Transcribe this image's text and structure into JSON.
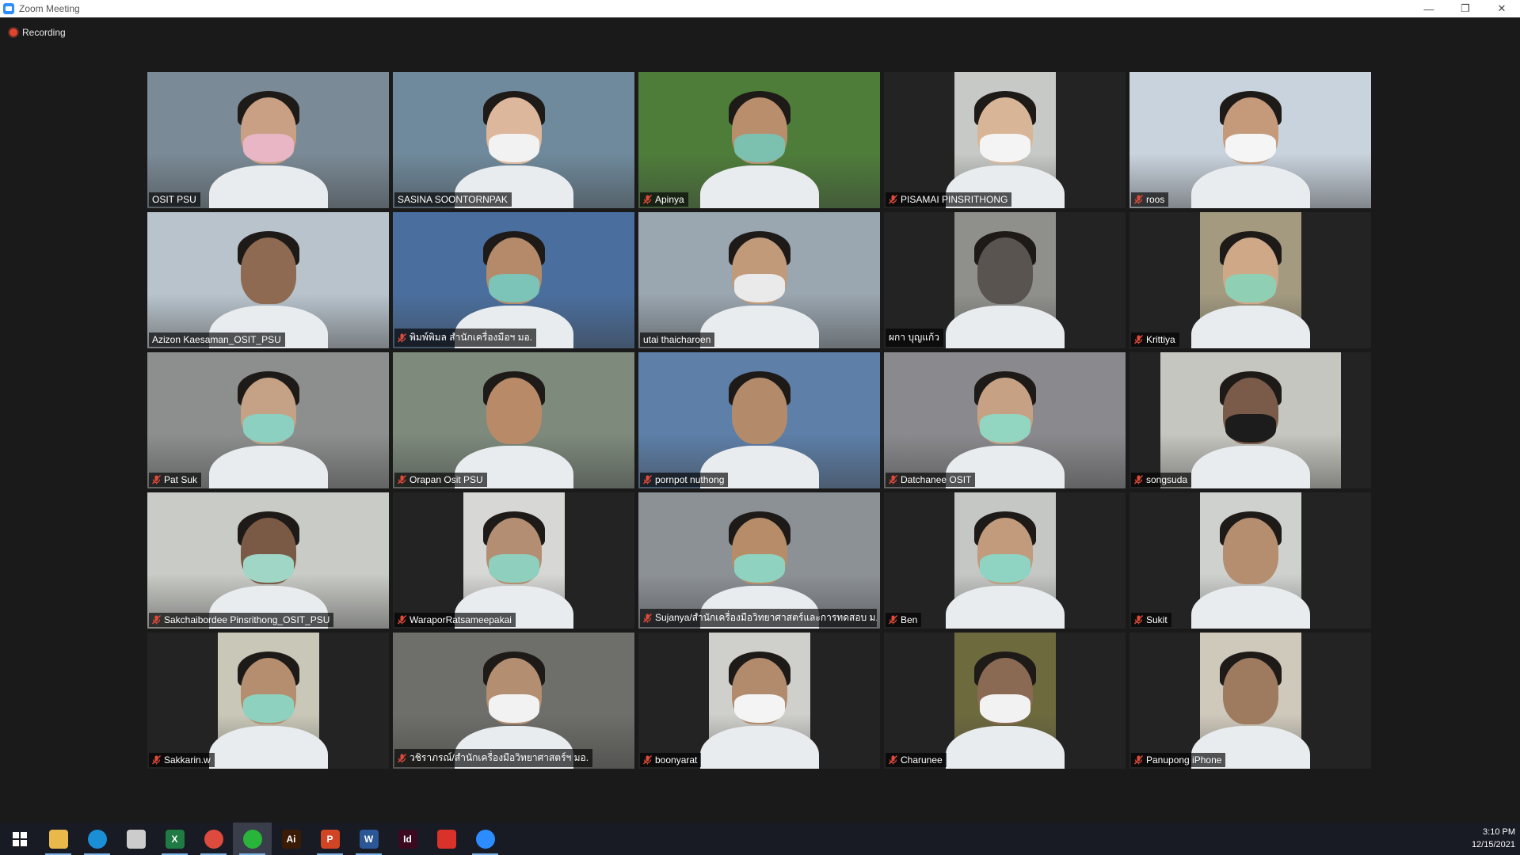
{
  "window": {
    "title": "Zoom Meeting",
    "controls": {
      "minimize": "—",
      "restore": "❐",
      "close": "✕"
    }
  },
  "recording": {
    "label": "Recording"
  },
  "participants": [
    {
      "name": "OSIT PSU",
      "muted": false,
      "active": false,
      "layout": "full",
      "bg": "#7a8a96",
      "face": "#c9a083",
      "mask": true,
      "mask_color": "#e8b6c4"
    },
    {
      "name": "SASINA SOONTORNPAK",
      "muted": false,
      "active": true,
      "layout": "full",
      "bg": "#6f8a9c",
      "face": "#dcb79b",
      "mask": true,
      "mask_color": "#f2f2f2"
    },
    {
      "name": "Apinya",
      "muted": true,
      "active": false,
      "layout": "full",
      "bg": "#4e7d3a",
      "face": "#b98e6c",
      "mask": true,
      "mask_color": "#7cc0b0"
    },
    {
      "name": "PISAMAI PINSRITHONG",
      "muted": true,
      "active": false,
      "layout": "portrait",
      "bg": "#c7c9c6",
      "face": "#d8b596",
      "mask": true,
      "mask_color": "#f4f4f4"
    },
    {
      "name": "roos",
      "muted": true,
      "active": false,
      "layout": "full",
      "bg": "#c9d3dd",
      "face": "#c49a7a",
      "mask": true,
      "mask_color": "#f5f5f5"
    },
    {
      "name": "Azizon Kaesaman_OSIT_PSU",
      "muted": false,
      "active": false,
      "layout": "full",
      "bg": "#b8c3cc",
      "face": "#8e6a52",
      "mask": false,
      "mask_color": ""
    },
    {
      "name": "พิมพ์พิมล สำนักเครื่องมือฯ มอ.",
      "muted": true,
      "active": false,
      "layout": "full",
      "bg": "#4a6f9e",
      "face": "#b48a6a",
      "mask": true,
      "mask_color": "#7cc3b8"
    },
    {
      "name": "utai thaicharoen",
      "muted": false,
      "active": false,
      "layout": "full",
      "bg": "#9aa6b0",
      "face": "#c19a7a",
      "mask": true,
      "mask_color": "#eaeaea"
    },
    {
      "name": "ผกา บุญแก้ว",
      "muted": false,
      "active": false,
      "layout": "portrait",
      "bg": "#8f8f8c",
      "face": "#5a5450",
      "mask": false,
      "mask_color": ""
    },
    {
      "name": "Krittiya",
      "muted": true,
      "active": false,
      "layout": "portrait",
      "bg": "#a39a80",
      "face": "#cfa888",
      "mask": true,
      "mask_color": "#8fd0b4"
    },
    {
      "name": "Pat Suk",
      "muted": true,
      "active": false,
      "layout": "full",
      "bg": "#8c8f8e",
      "face": "#c5a285",
      "mask": true,
      "mask_color": "#8bd0c0"
    },
    {
      "name": "Orapan Osit PSU",
      "muted": true,
      "active": false,
      "layout": "full",
      "bg": "#7d8a7c",
      "face": "#b88a68",
      "mask": false,
      "mask_color": ""
    },
    {
      "name": "pornpot nuthong",
      "muted": true,
      "active": false,
      "layout": "full",
      "bg": "#5d7fa8",
      "face": "#b38b6b",
      "mask": false,
      "mask_color": ""
    },
    {
      "name": "Datchanee OSIT",
      "muted": true,
      "active": false,
      "layout": "full",
      "bg": "#8a8a8e",
      "face": "#c7a184",
      "mask": true,
      "mask_color": "#92d6c2"
    },
    {
      "name": "songsuda",
      "muted": true,
      "active": false,
      "layout": "portrait-wide",
      "bg": "#c6c6c0",
      "face": "#7a5a48",
      "mask": true,
      "mask_color": "#1c1c1c"
    },
    {
      "name": "Sakchaibordee Pinsrithong_OSIT_PSU",
      "muted": true,
      "active": false,
      "layout": "full",
      "bg": "#c9cbc6",
      "face": "#7b5a45",
      "mask": true,
      "mask_color": "#9fd6c6"
    },
    {
      "name": "WaraporRatsameepakai",
      "muted": true,
      "active": false,
      "layout": "portrait",
      "bg": "#d7d8d5",
      "face": "#b48e72",
      "mask": true,
      "mask_color": "#8fcfbd"
    },
    {
      "name": "Sujanya/สำนักเครื่องมือวิทยาศาสตร์และการทดสอบ ม...",
      "muted": true,
      "active": false,
      "layout": "full",
      "bg": "#8c9196",
      "face": "#b78c68",
      "mask": true,
      "mask_color": "#8fd2c0"
    },
    {
      "name": "Ben",
      "muted": true,
      "active": false,
      "layout": "portrait",
      "bg": "#c5c7c4",
      "face": "#c29a7c",
      "mask": true,
      "mask_color": "#8fd3c3"
    },
    {
      "name": "Sukit",
      "muted": true,
      "active": false,
      "layout": "portrait",
      "bg": "#cfd1cf",
      "face": "#b58e70",
      "mask": false,
      "mask_color": ""
    },
    {
      "name": "Sakkarin.w",
      "muted": true,
      "active": false,
      "layout": "portrait",
      "bg": "#c9c8b8",
      "face": "#b48e6e",
      "mask": true,
      "mask_color": "#8fd1bf"
    },
    {
      "name": "วชิราภรณ์/สำนักเครื่องมือวิทยาศาสตร์ฯ มอ.",
      "muted": true,
      "active": false,
      "layout": "full",
      "bg": "#6e6e6a",
      "face": "#b48e70",
      "mask": true,
      "mask_color": "#f2f2f2"
    },
    {
      "name": "boonyarat",
      "muted": true,
      "active": false,
      "layout": "portrait",
      "bg": "#cfd0cc",
      "face": "#b28a6c",
      "mask": true,
      "mask_color": "#f4f4f4"
    },
    {
      "name": "Charunee",
      "muted": true,
      "active": false,
      "layout": "portrait",
      "bg": "#6d6a3e",
      "face": "#8a6a52",
      "mask": true,
      "mask_color": "#f2f2f2"
    },
    {
      "name": "Panupong iPhone",
      "muted": true,
      "active": false,
      "layout": "portrait",
      "bg": "#cfc9bc",
      "face": "#9e7a5e",
      "mask": false,
      "mask_color": ""
    }
  ],
  "taskbar": {
    "items": [
      {
        "name": "windows-start",
        "glyph": "",
        "color": "transparent",
        "running": false
      },
      {
        "name": "file-explorer",
        "glyph": "",
        "color": "#e8b84a",
        "running": true
      },
      {
        "name": "edge",
        "glyph": "",
        "color": "#1a8fd6",
        "running": true
      },
      {
        "name": "qr-app",
        "glyph": "",
        "color": "#cccccc",
        "running": false
      },
      {
        "name": "excel",
        "glyph": "X",
        "color": "#1f7a44",
        "running": true
      },
      {
        "name": "chrome",
        "glyph": "",
        "color": "#dd4b3e",
        "running": true
      },
      {
        "name": "line",
        "glyph": "",
        "color": "#29b43a",
        "running": true
      },
      {
        "name": "illustrator",
        "glyph": "Ai",
        "color": "#3a1c06",
        "running": false
      },
      {
        "name": "powerpoint",
        "glyph": "P",
        "color": "#d14524",
        "running": true
      },
      {
        "name": "word",
        "glyph": "W",
        "color": "#2b5797",
        "running": true
      },
      {
        "name": "indesign",
        "glyph": "Id",
        "color": "#3b0a1f",
        "running": false
      },
      {
        "name": "acrobat",
        "glyph": "",
        "color": "#d8322a",
        "running": false
      },
      {
        "name": "zoom",
        "glyph": "",
        "color": "#2d8cff",
        "running": true
      }
    ],
    "time": "3:10 PM",
    "date": "12/15/2021"
  }
}
